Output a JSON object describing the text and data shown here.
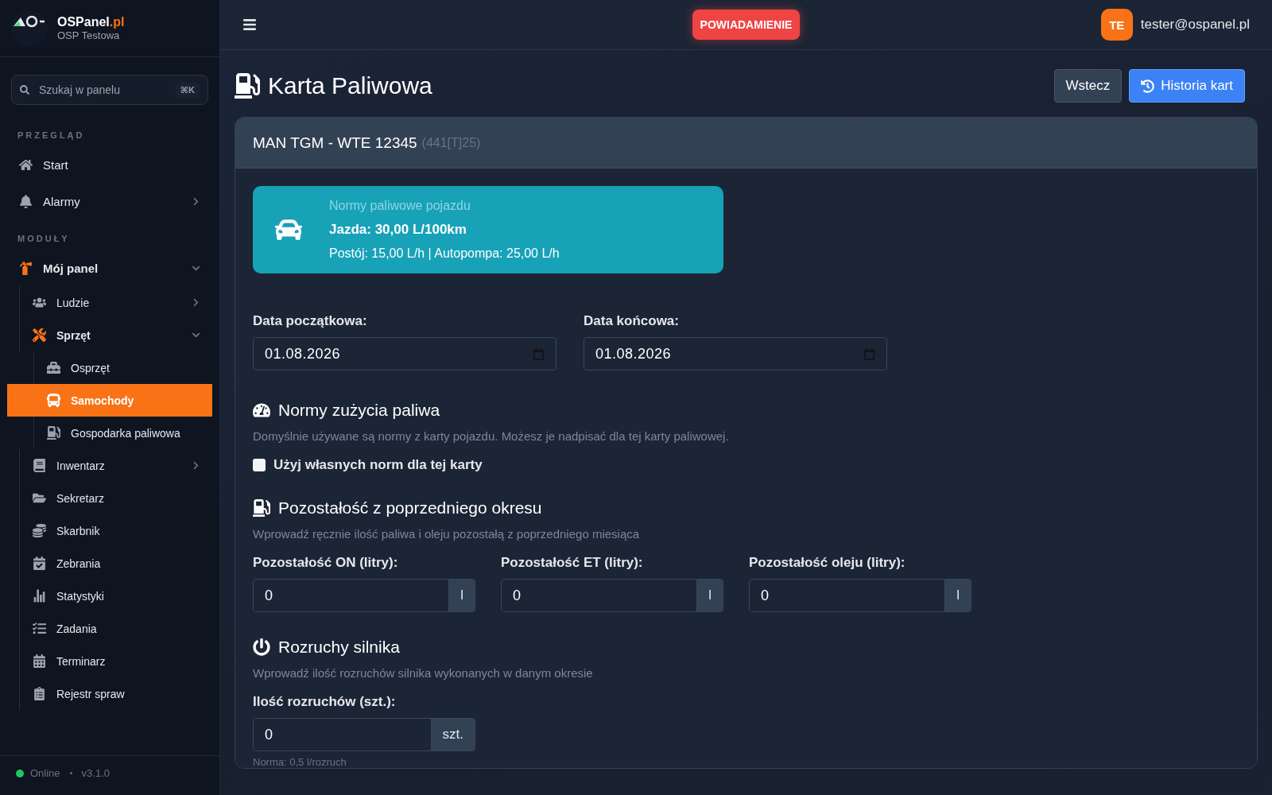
{
  "sidebar": {
    "brand": "OSPanel",
    "brand_suffix": ".pl",
    "unit": "OSP Testowa",
    "search": {
      "placeholder": "Szukaj w panelu",
      "shortcut": "⌘K"
    },
    "sections": [
      {
        "title": "PRZEGLĄD",
        "items": [
          {
            "label": "Start",
            "selected": false
          },
          {
            "label": "Alarmy",
            "selected": false,
            "expanded": false
          }
        ]
      },
      {
        "title": "MODUŁY",
        "items": [
          {
            "label": "Mój panel",
            "selected": false,
            "expanded": true,
            "children": [
              {
                "label": "Ludzie",
                "selected": false,
                "expanded": false
              },
              {
                "label": "Sprzęt",
                "selected": false,
                "expanded": true,
                "children": [
                  {
                    "label": "Osprzęt",
                    "selected": false
                  },
                  {
                    "label": "Samochody",
                    "selected": true
                  },
                  {
                    "label": "Gospodarka paliwowa",
                    "selected": false
                  }
                ]
              },
              {
                "label": "Inwentarz",
                "selected": false,
                "expanded": false
              },
              {
                "label": "Sekretarz",
                "selected": false
              },
              {
                "label": "Skarbnik",
                "selected": false
              },
              {
                "label": "Zebrania",
                "selected": false
              },
              {
                "label": "Statystyki",
                "selected": false
              },
              {
                "label": "Zadania",
                "selected": false
              },
              {
                "label": "Terminarz",
                "selected": false
              },
              {
                "label": "Rejestr spraw",
                "selected": false
              }
            ]
          }
        ]
      }
    ],
    "status": {
      "label": "Online",
      "color": "#22c55e",
      "version": "v3.1.0"
    }
  },
  "topbar": {
    "notification": "POWIADAMIENIE",
    "avatar": "TE",
    "user": "tester@ospanel.pl"
  },
  "page": {
    "title": "Karta Paliwowa",
    "buttons": [
      {
        "label": "Wstecz",
        "kind": "secondary"
      },
      {
        "label": "Historia kart",
        "kind": "primary"
      }
    ]
  },
  "card": {
    "vehicle": "MAN TGM - WTE 12345",
    "code": "(441[T]25)",
    "norms_box": {
      "title": "Normy paliwowe pojazdu",
      "main": "Jazda: 30,00 L/100km",
      "detail": "Postój: 15,00 L/h | Autopompa: 25,00 L/h"
    },
    "dates": [
      {
        "label": "Data początkowa:",
        "value": "01.08.2026"
      },
      {
        "label": "Data końcowa:",
        "value": "01.08.2026"
      }
    ],
    "sections": [
      {
        "title": "Normy zużycia paliwa",
        "description": "Domyślnie używane są normy z karty pojazdu. Możesz je nadpisać dla tej karty paliwowej.",
        "checkbox": {
          "label": "Użyj własnych norm dla tej karty",
          "checked": false
        }
      },
      {
        "title": "Pozostałość z poprzedniego okresu",
        "description": "Wprowadź ręcznie ilość paliwa i oleju pozostałą z poprzedniego miesiąca",
        "fields": [
          {
            "label": "Pozostałość ON (litry):",
            "value": "0",
            "unit": "l"
          },
          {
            "label": "Pozostałość ET (litry):",
            "value": "0",
            "unit": "l"
          },
          {
            "label": "Pozostałość oleju (litry):",
            "value": "0",
            "unit": "l"
          }
        ]
      },
      {
        "title": "Rozruchy silnika",
        "description": "Wprowadź ilość rozruchów silnika wykonanych w danym okresie",
        "fields": [
          {
            "label": "Ilość rozruchów (szt.):",
            "value": "0",
            "unit": "szt."
          }
        ],
        "note": "Norma: 0,5 l/rozruch"
      }
    ]
  }
}
